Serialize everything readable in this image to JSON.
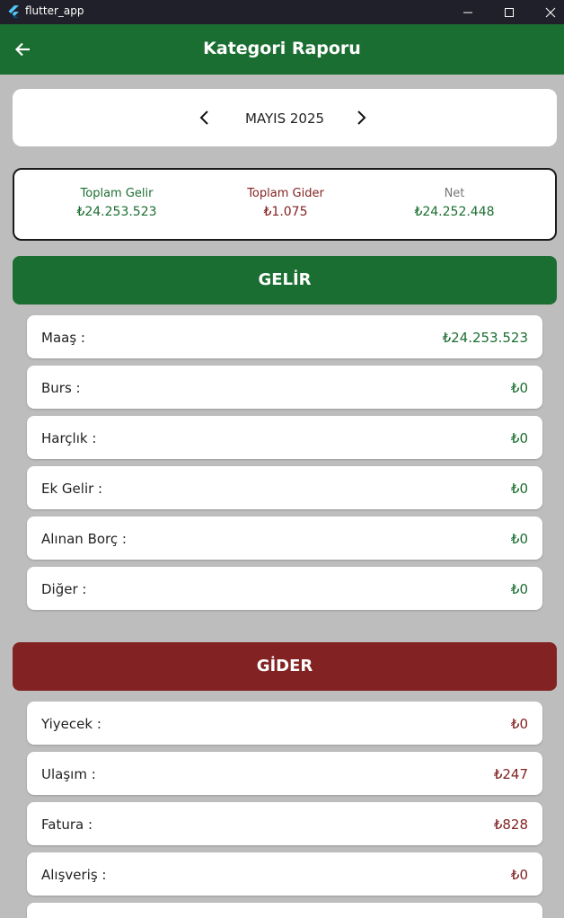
{
  "window": {
    "title": "flutter_app"
  },
  "appbar": {
    "title": "Kategori Raporu"
  },
  "month_selector": {
    "label": "MAYIS 2025"
  },
  "summary": {
    "income_label": "Toplam Gelir",
    "income_value": "₺24.253.523",
    "expense_label": "Toplam Gider",
    "expense_value": "₺1.075",
    "net_label": "Net",
    "net_value": "₺24.252.448"
  },
  "income": {
    "header": "GELİR",
    "rows": [
      {
        "label": "Maaş :",
        "value": "₺24.253.523"
      },
      {
        "label": "Burs :",
        "value": "₺0"
      },
      {
        "label": "Harçlık :",
        "value": "₺0"
      },
      {
        "label": "Ek Gelir :",
        "value": "₺0"
      },
      {
        "label": "Alınan Borç :",
        "value": "₺0"
      },
      {
        "label": "Diğer :",
        "value": "₺0"
      }
    ]
  },
  "expense": {
    "header": "GİDER",
    "rows": [
      {
        "label": "Yiyecek :",
        "value": "₺0"
      },
      {
        "label": "Ulaşım :",
        "value": "₺247"
      },
      {
        "label": "Fatura :",
        "value": "₺828"
      },
      {
        "label": "Alışveriş :",
        "value": "₺0"
      }
    ]
  },
  "colors": {
    "appbar": "#1b6e31",
    "income": "#1b6e31",
    "expense": "#822222",
    "background": "#bdbdbd"
  }
}
